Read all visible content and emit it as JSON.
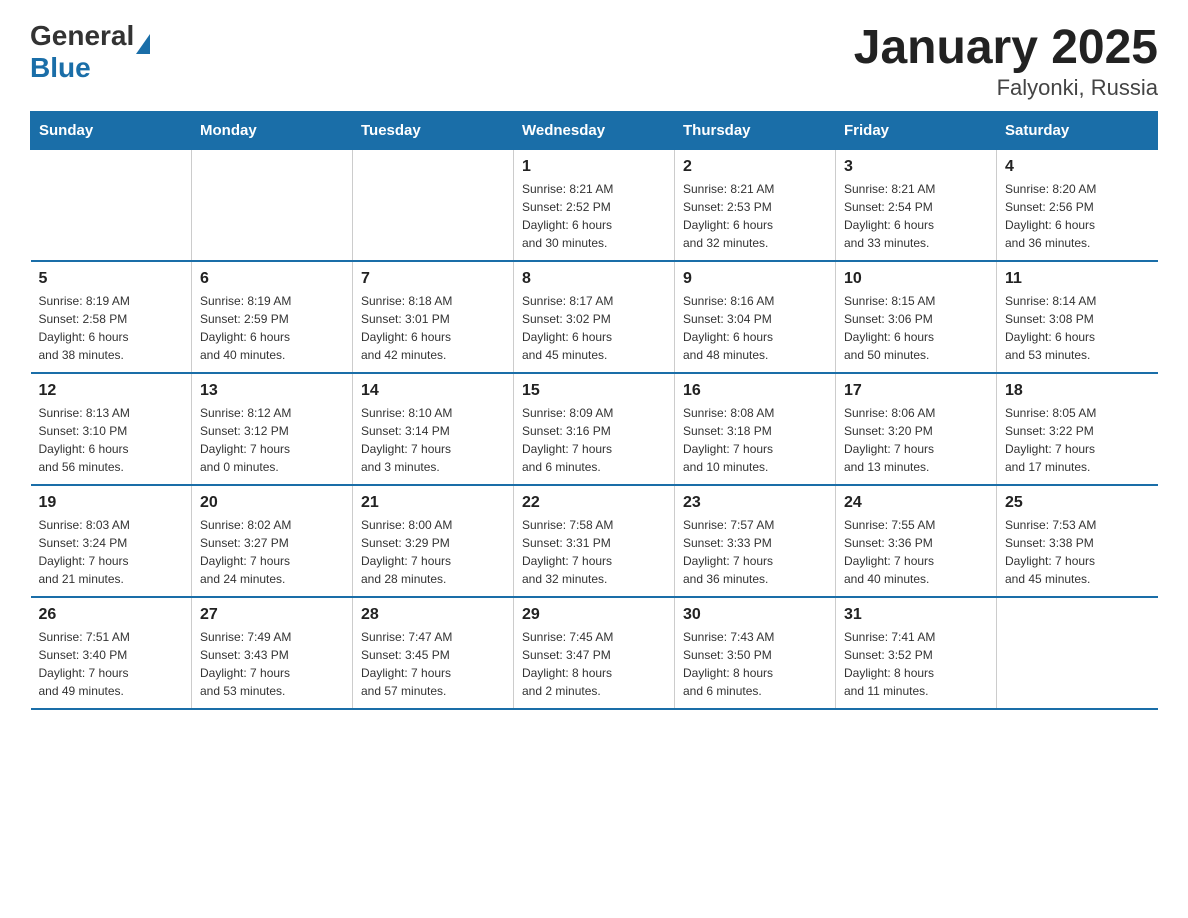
{
  "logo": {
    "general": "General",
    "blue": "Blue"
  },
  "title": "January 2025",
  "subtitle": "Falyonki, Russia",
  "headers": [
    "Sunday",
    "Monday",
    "Tuesday",
    "Wednesday",
    "Thursday",
    "Friday",
    "Saturday"
  ],
  "weeks": [
    [
      {
        "day": "",
        "info": ""
      },
      {
        "day": "",
        "info": ""
      },
      {
        "day": "",
        "info": ""
      },
      {
        "day": "1",
        "info": "Sunrise: 8:21 AM\nSunset: 2:52 PM\nDaylight: 6 hours\nand 30 minutes."
      },
      {
        "day": "2",
        "info": "Sunrise: 8:21 AM\nSunset: 2:53 PM\nDaylight: 6 hours\nand 32 minutes."
      },
      {
        "day": "3",
        "info": "Sunrise: 8:21 AM\nSunset: 2:54 PM\nDaylight: 6 hours\nand 33 minutes."
      },
      {
        "day": "4",
        "info": "Sunrise: 8:20 AM\nSunset: 2:56 PM\nDaylight: 6 hours\nand 36 minutes."
      }
    ],
    [
      {
        "day": "5",
        "info": "Sunrise: 8:19 AM\nSunset: 2:58 PM\nDaylight: 6 hours\nand 38 minutes."
      },
      {
        "day": "6",
        "info": "Sunrise: 8:19 AM\nSunset: 2:59 PM\nDaylight: 6 hours\nand 40 minutes."
      },
      {
        "day": "7",
        "info": "Sunrise: 8:18 AM\nSunset: 3:01 PM\nDaylight: 6 hours\nand 42 minutes."
      },
      {
        "day": "8",
        "info": "Sunrise: 8:17 AM\nSunset: 3:02 PM\nDaylight: 6 hours\nand 45 minutes."
      },
      {
        "day": "9",
        "info": "Sunrise: 8:16 AM\nSunset: 3:04 PM\nDaylight: 6 hours\nand 48 minutes."
      },
      {
        "day": "10",
        "info": "Sunrise: 8:15 AM\nSunset: 3:06 PM\nDaylight: 6 hours\nand 50 minutes."
      },
      {
        "day": "11",
        "info": "Sunrise: 8:14 AM\nSunset: 3:08 PM\nDaylight: 6 hours\nand 53 minutes."
      }
    ],
    [
      {
        "day": "12",
        "info": "Sunrise: 8:13 AM\nSunset: 3:10 PM\nDaylight: 6 hours\nand 56 minutes."
      },
      {
        "day": "13",
        "info": "Sunrise: 8:12 AM\nSunset: 3:12 PM\nDaylight: 7 hours\nand 0 minutes."
      },
      {
        "day": "14",
        "info": "Sunrise: 8:10 AM\nSunset: 3:14 PM\nDaylight: 7 hours\nand 3 minutes."
      },
      {
        "day": "15",
        "info": "Sunrise: 8:09 AM\nSunset: 3:16 PM\nDaylight: 7 hours\nand 6 minutes."
      },
      {
        "day": "16",
        "info": "Sunrise: 8:08 AM\nSunset: 3:18 PM\nDaylight: 7 hours\nand 10 minutes."
      },
      {
        "day": "17",
        "info": "Sunrise: 8:06 AM\nSunset: 3:20 PM\nDaylight: 7 hours\nand 13 minutes."
      },
      {
        "day": "18",
        "info": "Sunrise: 8:05 AM\nSunset: 3:22 PM\nDaylight: 7 hours\nand 17 minutes."
      }
    ],
    [
      {
        "day": "19",
        "info": "Sunrise: 8:03 AM\nSunset: 3:24 PM\nDaylight: 7 hours\nand 21 minutes."
      },
      {
        "day": "20",
        "info": "Sunrise: 8:02 AM\nSunset: 3:27 PM\nDaylight: 7 hours\nand 24 minutes."
      },
      {
        "day": "21",
        "info": "Sunrise: 8:00 AM\nSunset: 3:29 PM\nDaylight: 7 hours\nand 28 minutes."
      },
      {
        "day": "22",
        "info": "Sunrise: 7:58 AM\nSunset: 3:31 PM\nDaylight: 7 hours\nand 32 minutes."
      },
      {
        "day": "23",
        "info": "Sunrise: 7:57 AM\nSunset: 3:33 PM\nDaylight: 7 hours\nand 36 minutes."
      },
      {
        "day": "24",
        "info": "Sunrise: 7:55 AM\nSunset: 3:36 PM\nDaylight: 7 hours\nand 40 minutes."
      },
      {
        "day": "25",
        "info": "Sunrise: 7:53 AM\nSunset: 3:38 PM\nDaylight: 7 hours\nand 45 minutes."
      }
    ],
    [
      {
        "day": "26",
        "info": "Sunrise: 7:51 AM\nSunset: 3:40 PM\nDaylight: 7 hours\nand 49 minutes."
      },
      {
        "day": "27",
        "info": "Sunrise: 7:49 AM\nSunset: 3:43 PM\nDaylight: 7 hours\nand 53 minutes."
      },
      {
        "day": "28",
        "info": "Sunrise: 7:47 AM\nSunset: 3:45 PM\nDaylight: 7 hours\nand 57 minutes."
      },
      {
        "day": "29",
        "info": "Sunrise: 7:45 AM\nSunset: 3:47 PM\nDaylight: 8 hours\nand 2 minutes."
      },
      {
        "day": "30",
        "info": "Sunrise: 7:43 AM\nSunset: 3:50 PM\nDaylight: 8 hours\nand 6 minutes."
      },
      {
        "day": "31",
        "info": "Sunrise: 7:41 AM\nSunset: 3:52 PM\nDaylight: 8 hours\nand 11 minutes."
      },
      {
        "day": "",
        "info": ""
      }
    ]
  ]
}
